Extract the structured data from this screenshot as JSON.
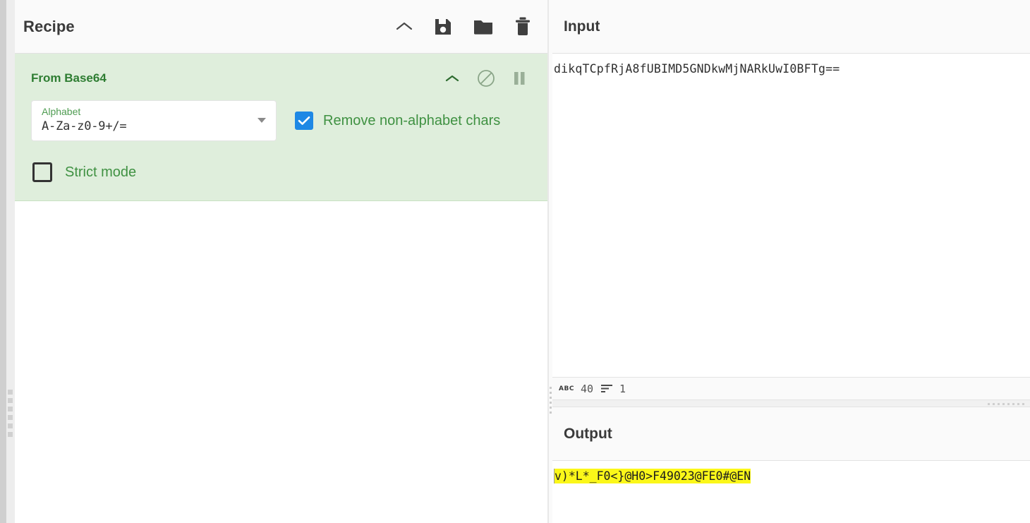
{
  "recipe": {
    "title": "Recipe",
    "title_icons": [
      {
        "name": "collapse-chevron-icon",
        "glyph": "chevron-up"
      },
      {
        "name": "save-recipe-icon",
        "glyph": "floppy-disk"
      },
      {
        "name": "load-recipe-icon",
        "glyph": "folder"
      },
      {
        "name": "clear-recipe-icon",
        "glyph": "trash"
      }
    ],
    "operation": {
      "name": "From Base64",
      "icons": [
        {
          "name": "operation-collapse-icon",
          "glyph": "chevron-up"
        },
        {
          "name": "disable-operation-icon",
          "glyph": "circle-slash"
        },
        {
          "name": "pause-operation-icon",
          "glyph": "pause"
        }
      ],
      "alphabet": {
        "label": "Alphabet",
        "value": "A-Za-z0-9+/=",
        "caret": "chevron-down-icon"
      },
      "remove_non_alphabet": {
        "label": "Remove non-alphabet chars",
        "checked": true
      },
      "strict_mode": {
        "label": "Strict mode",
        "checked": false
      }
    }
  },
  "input": {
    "title": "Input",
    "value": "dikqTCpfRjA8fUBIMD5GNDkwMjNARkUwI0BFTg==",
    "status": {
      "length_icon": "ABC",
      "length": "40",
      "lines_icon": "lines-icon",
      "lines": "1"
    }
  },
  "output": {
    "title": "Output",
    "value": "v)*L*_F0<}@H0>F49023@FE0#@EN"
  },
  "colors": {
    "operation_bg": "#dfeedc",
    "operation_title": "#2e7d32",
    "checkbox_checked": "#1e88e5",
    "highlight": "#fbf719"
  }
}
